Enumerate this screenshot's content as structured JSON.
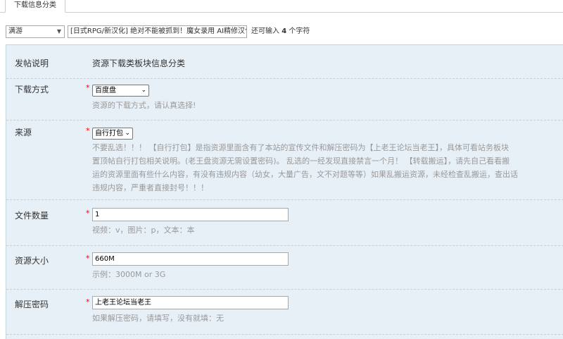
{
  "tabs": {
    "active": "下载信息分类"
  },
  "titlebar": {
    "type_select": "满游",
    "title_value": "[日式RPG/新汉化] 绝对不能被抓到！魔女录用 AI精修汉化",
    "remain_prefix": "还可输入",
    "remain_count": "4",
    "remain_suffix": "个字符"
  },
  "form": {
    "intro": {
      "label": "发帖说明",
      "text": "资源下载类板块信息分类"
    },
    "download": {
      "label": "下载方式",
      "value": "百度盘",
      "hint": "资源的下载方式，请认真选择!"
    },
    "source": {
      "label": "来源",
      "value": "自行打包",
      "hint_lines": [
        "不要乱选！！！ 【自行打包】是指资源里面含有了本站的宣传文件和解压密码为【上老王论坛当老王】，具体可看站务板块",
        "置顶帖自行打包相关说明。(老王盘资源无需设置密码)。 乱选的一经发现直接禁言一个月！ 【转载搬运】，请先自己看看搬",
        "运的资源里面有些什么内容，有没有违规内容（幼女，大量广告，文不对题等等）如果乱搬运资源，未经检查乱搬运，查出话",
        "违规内容，严重者直接封号！！！"
      ]
    },
    "file_count": {
      "label": "文件数量",
      "value": "1",
      "hint": "视频：v，图片：p，文本：本"
    },
    "size": {
      "label": "资源大小",
      "value": "660M",
      "hint": "示例：3000M or 3G"
    },
    "password": {
      "label": "解压密码",
      "value": "上老王论坛当老王",
      "hint": "如果解压密码，请填写，没有就填：无"
    }
  },
  "colors": {
    "panel_bg": "#e8f0f7",
    "required": "#ff0000",
    "hint": "#999999"
  }
}
